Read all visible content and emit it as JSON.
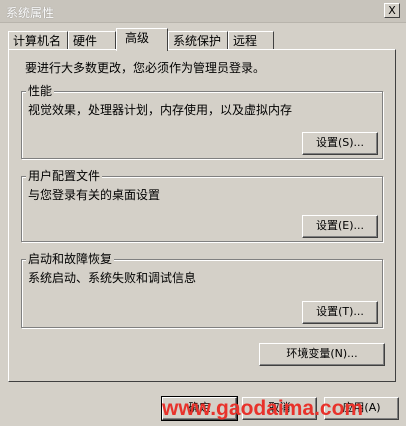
{
  "window": {
    "title": "系统属性",
    "close_label": "X"
  },
  "tabs": [
    {
      "label": "计算机名",
      "active": false
    },
    {
      "label": "硬件",
      "active": false
    },
    {
      "label": "高级",
      "active": true
    },
    {
      "label": "系统保护",
      "active": false
    },
    {
      "label": "远程",
      "active": false
    }
  ],
  "notice": "要进行大多数更改，您必须作为管理员登录。",
  "groups": {
    "performance": {
      "title": "性能",
      "description": "视觉效果，处理器计划，内存使用，以及虚拟内存",
      "button": "设置(S)..."
    },
    "user_profiles": {
      "title": "用户配置文件",
      "description": "与您登录有关的桌面设置",
      "button": "设置(E)..."
    },
    "startup_recovery": {
      "title": "启动和故障恢复",
      "description": "系统启动、系统失败和调试信息",
      "button": "设置(T)..."
    }
  },
  "env_button": "环境变量(N)...",
  "footer": {
    "ok": "确定",
    "cancel": "取消",
    "apply": "应用(A)"
  },
  "watermark": "www.gaodaima.com",
  "colors": {
    "dialog_bg": "#d4d0c8",
    "watermark": "#e8322b"
  }
}
